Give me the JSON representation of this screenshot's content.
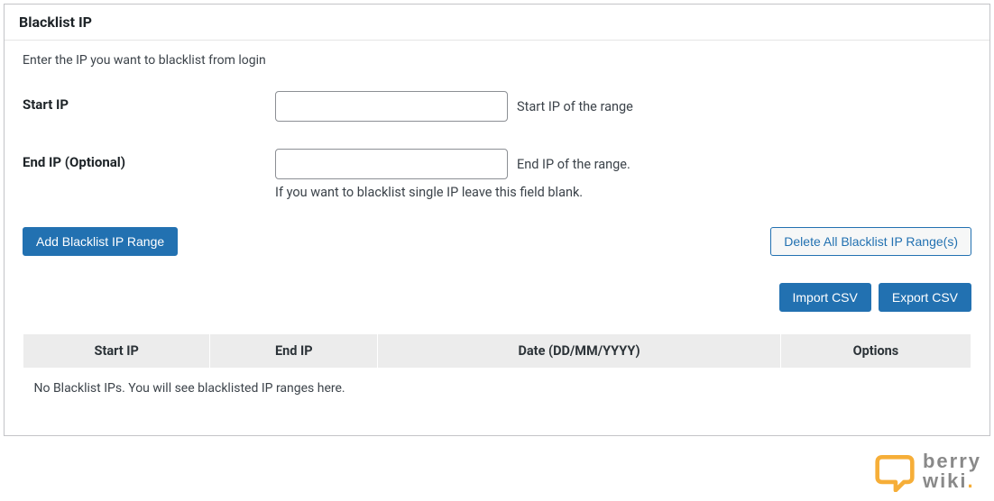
{
  "panel": {
    "title": "Blacklist IP",
    "description": "Enter the IP you want to blacklist from login"
  },
  "form": {
    "start_ip": {
      "label": "Start IP",
      "value": "",
      "hint": "Start IP of the range"
    },
    "end_ip": {
      "label": "End IP (Optional)",
      "value": "",
      "hint": "End IP of the range.",
      "sub_hint": "If you want to blacklist single IP leave this field blank."
    }
  },
  "buttons": {
    "add": "Add Blacklist IP Range",
    "delete_all": "Delete All Blacklist IP Range(s)",
    "import_csv": "Import CSV",
    "export_csv": "Export CSV"
  },
  "table": {
    "headers": {
      "start_ip": "Start IP",
      "end_ip": "End IP",
      "date": "Date (DD/MM/YYYY)",
      "options": "Options"
    },
    "empty_message": "No Blacklist IPs. You will see blacklisted IP ranges here."
  },
  "watermark": {
    "line1": "berry",
    "line2": "wiki"
  }
}
